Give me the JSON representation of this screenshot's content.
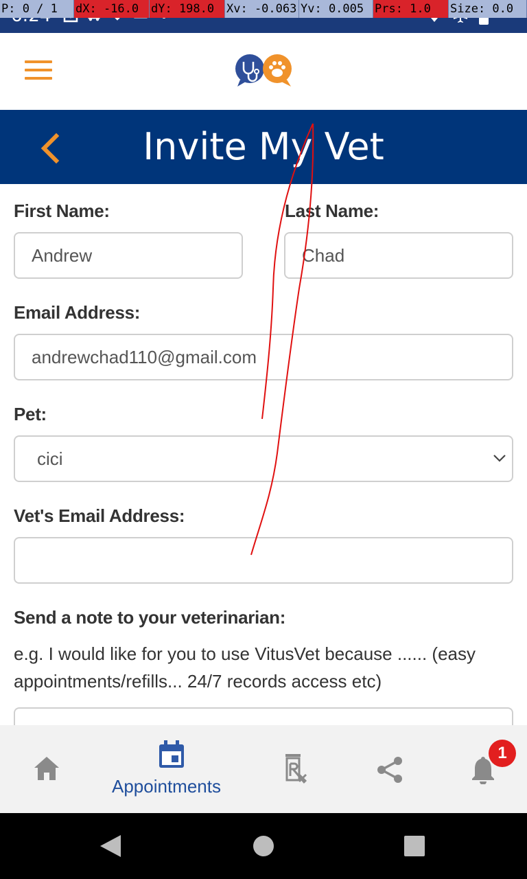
{
  "status_bar": {
    "time": "6:24",
    "debug": [
      {
        "text": "P: 0 / 1",
        "highlight": false
      },
      {
        "text": "dX: -16.0",
        "highlight": true
      },
      {
        "text": "dY: 198.0",
        "highlight": true
      },
      {
        "text": "Xv: -0.063",
        "highlight": false
      },
      {
        "text": "Yv: 0.005",
        "highlight": false
      },
      {
        "text": "Prs: 1.0",
        "highlight": true
      },
      {
        "text": "Size: 0.0",
        "highlight": false
      }
    ]
  },
  "header": {
    "menu_icon": "hamburger-icon",
    "logo_icon": "vitusvet-logo"
  },
  "title_bar": {
    "title": "Invite My Vet",
    "back_icon": "chevron-left-icon"
  },
  "form": {
    "first_name_label": "First Name:",
    "first_name_value": "Andrew",
    "last_name_label": "Last Name:",
    "last_name_value": "Chad",
    "email_label": "Email Address:",
    "email_value": "andrewchad110@gmail.com",
    "pet_label": "Pet:",
    "pet_value": "cici",
    "vet_email_label": "Vet's Email Address:",
    "vet_email_value": "",
    "note_label": "Send a note to your veterinarian:",
    "note_helper": "e.g. I would like for you to use VitusVet because ...... (easy appointments/refills... 24/7 records access etc)"
  },
  "bottom_nav": {
    "items": [
      {
        "icon": "home-icon",
        "label": ""
      },
      {
        "icon": "calendar-icon",
        "label": "Appointments"
      },
      {
        "icon": "prescription-icon",
        "label": ""
      },
      {
        "icon": "share-icon",
        "label": ""
      },
      {
        "icon": "bell-icon",
        "label": ""
      }
    ],
    "notification_count": "1"
  },
  "colors": {
    "primary": "#00357a",
    "accent": "#f0922b",
    "nav_active": "#1f4e9c",
    "badge": "#e21f1f"
  }
}
